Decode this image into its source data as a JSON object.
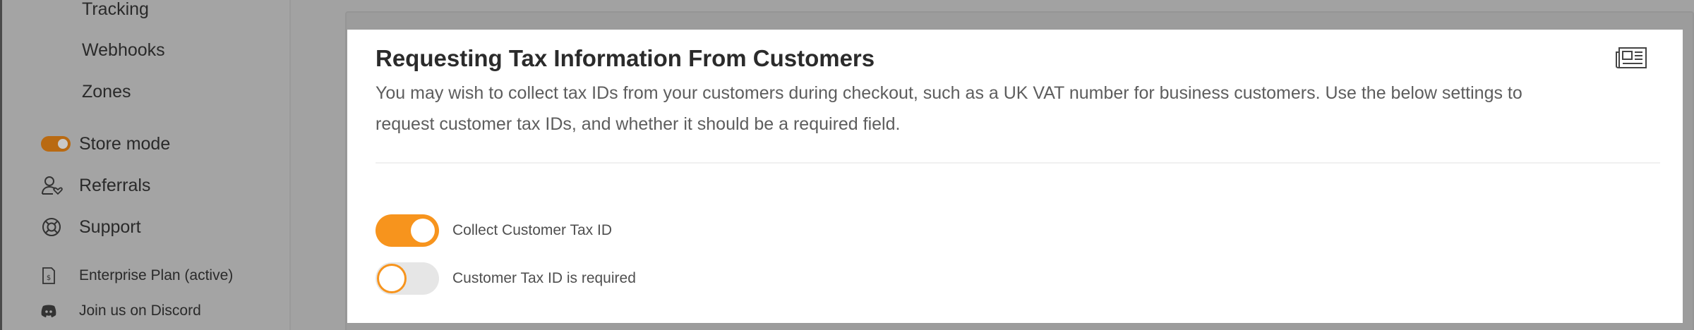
{
  "sidebar": {
    "sub_items": [
      "Tracking",
      "Webhooks",
      "Zones"
    ],
    "main_items": [
      {
        "label": "Store mode",
        "icon": "toggle-icon"
      },
      {
        "label": "Referrals",
        "icon": "user-heart-icon"
      },
      {
        "label": "Support",
        "icon": "lifebuoy-icon"
      }
    ],
    "footer_items": [
      {
        "label": "Enterprise Plan (active)",
        "icon": "invoice-icon"
      },
      {
        "label": "Join us on Discord",
        "icon": "discord-icon"
      }
    ]
  },
  "modal": {
    "title": "Requesting Tax Information From Customers",
    "description": "You may wish to collect tax IDs from your customers during checkout, such as a UK VAT number for business customers. Use the below settings to request customer tax IDs, and whether it should be a required field.",
    "icon": "newspaper-icon",
    "toggles": [
      {
        "label": "Collect Customer Tax ID",
        "enabled": true
      },
      {
        "label": "Customer Tax ID is required",
        "enabled": false
      }
    ]
  },
  "colors": {
    "accent": "#f7941d",
    "overlay": "#a2a2a2",
    "title": "#2b2b2b",
    "text": "#5d5d5d"
  }
}
